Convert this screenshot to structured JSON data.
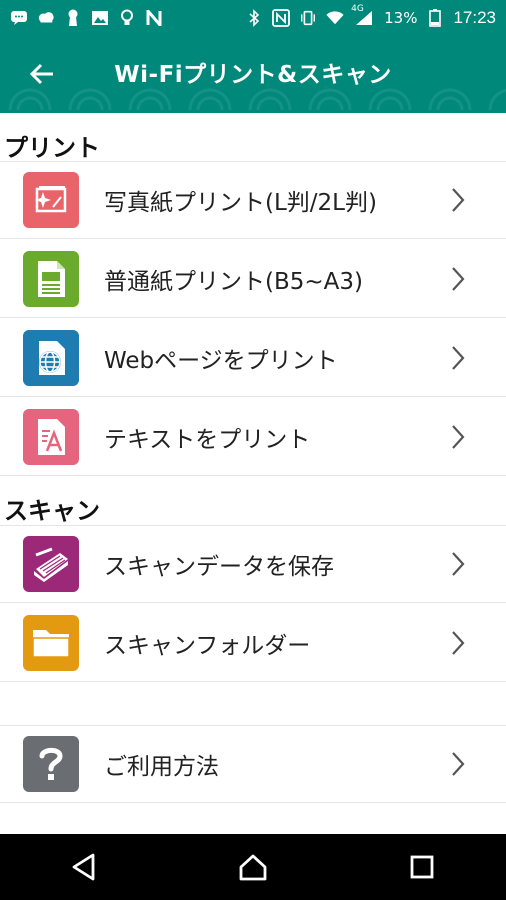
{
  "status_bar": {
    "battery_percent": "13%",
    "signal_tag": "4G",
    "time": "17:23",
    "icons": [
      "messenger-icon",
      "cloud-chat-icon",
      "keyhole-icon",
      "image-icon",
      "bulb-icon",
      "n-icon",
      "bluetooth-icon",
      "nfc-icon",
      "vibrate-icon",
      "wifi-icon",
      "cell-signal-icon",
      "battery-icon"
    ]
  },
  "app_bar": {
    "title": "Wi-Fiプリント&スキャン",
    "back_icon": "back-arrow-icon",
    "color": "#00897b"
  },
  "sections": {
    "print": {
      "header": "プリント",
      "items": [
        {
          "label": "写真紙プリント(L判/2L判)",
          "icon": "photo-print-icon",
          "color": "#e8636a"
        },
        {
          "label": "普通紙プリント(B5~A3)",
          "icon": "document-print-icon",
          "color": "#6aab2e"
        },
        {
          "label": "Webページをプリント",
          "icon": "web-globe-icon",
          "color": "#1f7cb1"
        },
        {
          "label": "テキストをプリント",
          "icon": "text-print-icon",
          "color": "#e4657d"
        }
      ]
    },
    "scan": {
      "header": "スキャン",
      "items": [
        {
          "label": "スキャンデータを保存",
          "icon": "scanner-icon",
          "color": "#9c2878"
        },
        {
          "label": "スキャンフォルダー",
          "icon": "folder-icon",
          "color": "#e49a10"
        }
      ]
    },
    "help": {
      "items": [
        {
          "label": "ご利用方法",
          "icon": "help-question-icon",
          "color": "#6a6e73"
        }
      ]
    }
  },
  "nav_bar": {
    "buttons": [
      "nav-back-icon",
      "nav-home-icon",
      "nav-recents-icon"
    ]
  }
}
